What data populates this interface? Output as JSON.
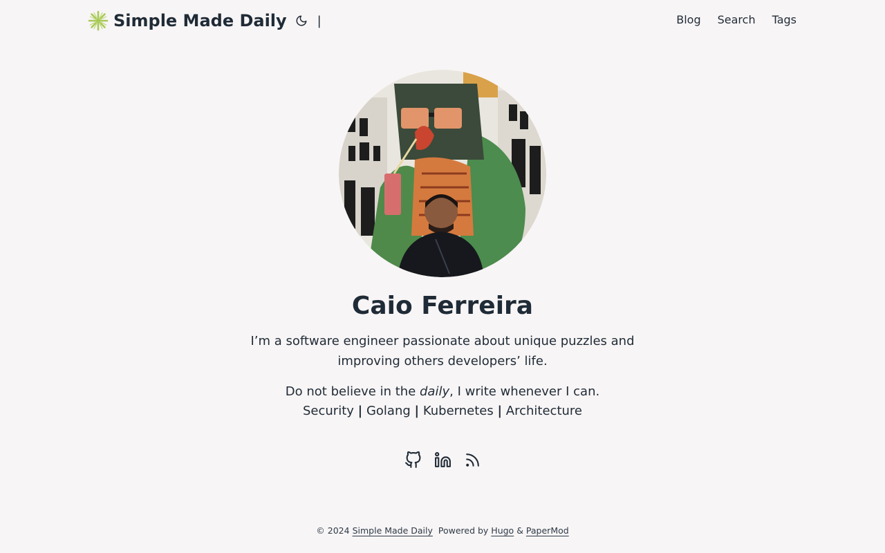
{
  "site": {
    "title": "Simple Made Daily",
    "separator": "|"
  },
  "menu": [
    {
      "label": "Blog"
    },
    {
      "label": "Search"
    },
    {
      "label": "Tags"
    }
  ],
  "profile": {
    "name": "Caio Ferreira",
    "bio_line": "I’m a software engineer passionate about unique puzzles and improving others developers’ life.",
    "bio2_prefix": "Do not believe in the ",
    "bio2_em": "daily",
    "bio2_suffix": ", I write whenever I can.",
    "topics": [
      "Security",
      "Golang",
      "Kubernetes",
      "Architecture"
    ],
    "topic_separator": "|",
    "social_icons": [
      "github-icon",
      "linkedin-icon",
      "rss-icon"
    ]
  },
  "footer": {
    "copyright": "© 2024",
    "site_link": "Simple Made Daily",
    "powered_by": "Powered by",
    "hugo": "Hugo",
    "amp": "&",
    "papermod": "PaperMod"
  },
  "colors": {
    "background": "#f8f5f6",
    "text": "#1f2b36",
    "logo_accent": "#a7c957"
  }
}
